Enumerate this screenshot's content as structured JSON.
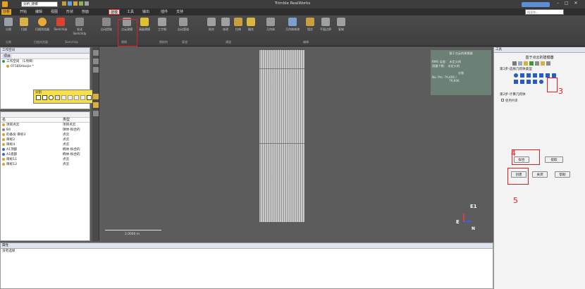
{
  "titlebar": {
    "app_title": "Trimble RealWorks",
    "project_dropdown": "分析_建模",
    "search_hint": "搜索和..."
  },
  "menu": {
    "items": [
      "分析",
      "开始",
      "编辑",
      "视图",
      "形状",
      "剖面",
      "建模",
      "工具",
      "输出",
      "插件",
      "支持"
    ],
    "active": "建模"
  },
  "ribbon": {
    "buttons": [
      {
        "label": "分割"
      },
      {
        "label": "扫描"
      },
      {
        "label": "扫描浏览器"
      },
      {
        "label": "SketchUp"
      },
      {
        "label": "发送SketchUp"
      },
      {
        "label": "自动提取"
      },
      {
        "label": "点云建模"
      },
      {
        "label": "高级建模"
      },
      {
        "label": "工字钢"
      },
      {
        "label": "自动管道"
      },
      {
        "label": "拟合"
      },
      {
        "label": "修改"
      },
      {
        "label": "拉伸"
      },
      {
        "label": "缝合"
      },
      {
        "label": "几何体"
      },
      {
        "label": "几何体修改"
      },
      {
        "label": "相交"
      },
      {
        "label": "平面边界"
      },
      {
        "label": "复制"
      }
    ],
    "groups": [
      "分割",
      "扫描浏览器",
      "SketchUp",
      "建模",
      "钢结构",
      "管道",
      "通道",
      "编辑"
    ]
  },
  "workspace": {
    "title": "工作空间",
    "toolbar_label": "项目",
    "tree": [
      {
        "label": "工作空间 （1项目）"
      },
      {
        "label": "0718SHaojie *"
      }
    ]
  },
  "floating_toolbar": {
    "title": "分割"
  },
  "list": {
    "headers": [
      "名",
      "类型"
    ],
    "rows": [
      {
        "name": "项目点云",
        "type": "项目点云"
      },
      {
        "name": "B4",
        "type": "球体-拟合的"
      },
      {
        "name": "的备份 目标3",
        "type": "点云"
      },
      {
        "name": "目标2",
        "type": "点云"
      },
      {
        "name": "目标4",
        "type": "点云"
      },
      {
        "name": "A1顶部",
        "type": "椭体-拟合的"
      },
      {
        "name": "A1底部",
        "type": "椭体-拟合的"
      },
      {
        "name": "目标11",
        "type": "点云"
      },
      {
        "name": "目标12",
        "type": "点云"
      }
    ]
  },
  "properties": {
    "title": "属性",
    "empty_text": "没有选择"
  },
  "viewport": {
    "scale_label": "2.0000 m",
    "info_title": "基于点云的建模器",
    "info_lines": [
      "RMS 误差： 未定义的",
      "测量个数： 未定义的",
      "分割",
      "No. Pts: 79,606 /",
      "79,606"
    ],
    "axis_e": "E",
    "axis_n": "N",
    "axis_e1": "E1"
  },
  "tools": {
    "panel_title": "工具",
    "header": "基于点云的建模器",
    "step1": "第1步-选择几何体类型",
    "step2": "第2步-计算几何体",
    "checkbox_label": "使用约束",
    "fit_button": "拟合",
    "extract_button": "提取",
    "create_button": "创建",
    "close_button": "关闭",
    "help_button": "帮助"
  },
  "annotations": {
    "n3": "3",
    "n4": "4",
    "n5": "5"
  },
  "colors": {
    "annotation": "#e02020",
    "panel_header": "#dde4ee",
    "viewport": "#5a5a5a",
    "ribbon": "#454545"
  }
}
